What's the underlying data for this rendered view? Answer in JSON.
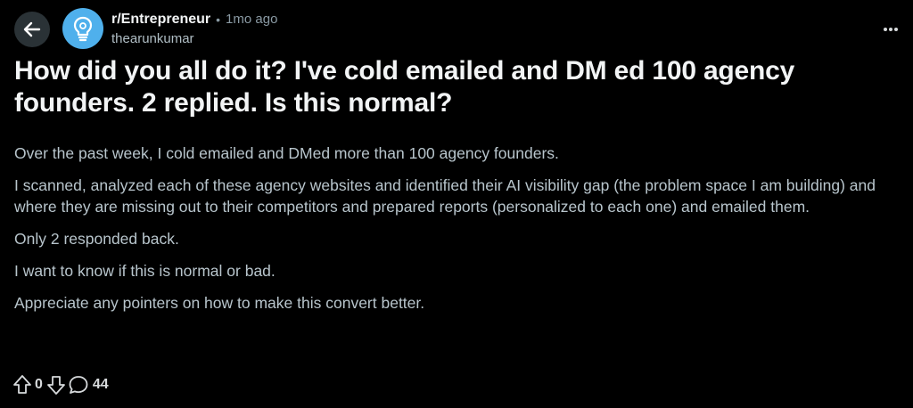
{
  "header": {
    "subreddit": "r/Entrepreneur",
    "separator": "•",
    "time_ago": "1mo ago",
    "author": "thearunkumar"
  },
  "post": {
    "title": "How did you all do it? I've cold emailed and DM ed 100 agency founders. 2 replied. Is this normal?",
    "paragraphs": [
      "Over the past week, I cold emailed and DMed more than 100 agency founders.",
      "I scanned, analyzed each of these agency websites and identified their AI visibility gap (the problem space I am building) and where they are missing out to their competitors and prepared reports (personalized to each one) and emailed them.",
      "Only 2 responded back.",
      "I want to know if this is normal or bad.",
      "Appreciate any pointers on how to make this convert better."
    ]
  },
  "actions": {
    "vote_count": "0",
    "comment_count": "44"
  },
  "icons": {
    "back": "arrow-left-icon",
    "subreddit": "lightbulb-icon",
    "more": "more-horizontal-icon",
    "upvote": "upvote-arrow-icon",
    "downvote": "downvote-arrow-icon",
    "comment": "comment-bubble-icon"
  },
  "colors": {
    "background": "#000000",
    "avatar": "#4fb0ec",
    "back_button": "#2a3236"
  }
}
